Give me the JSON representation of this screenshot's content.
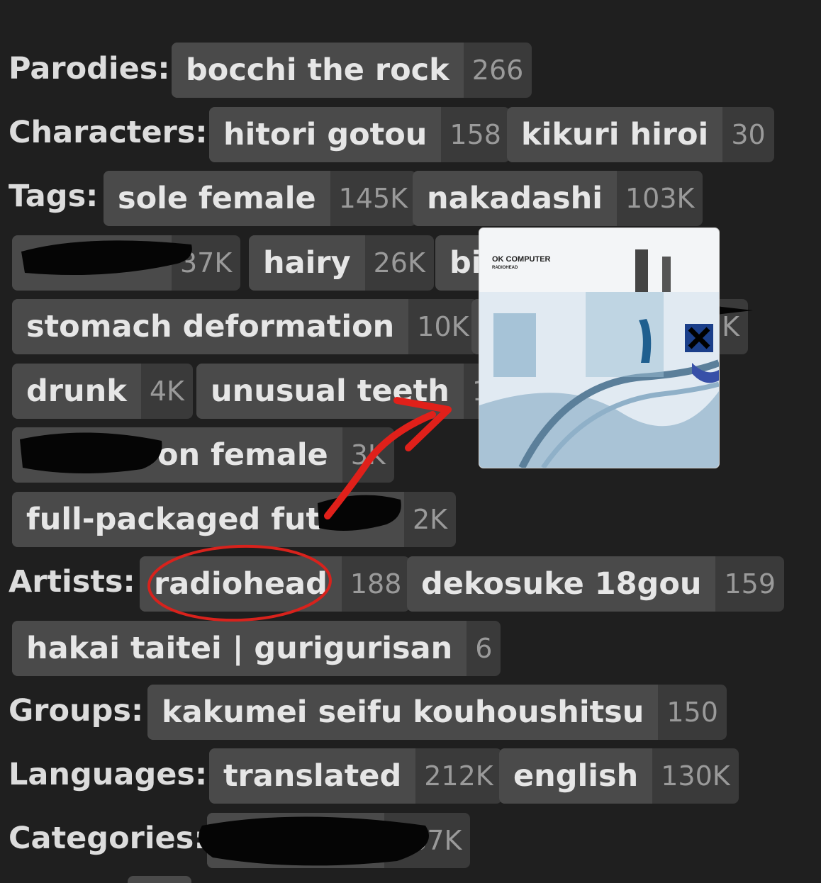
{
  "sections": {
    "parodies": "Parodies:",
    "characters": "Characters:",
    "tags": "Tags:",
    "artists": "Artists:",
    "groups": "Groups:",
    "languages": "Languages:",
    "categories": "Categories:"
  },
  "parodies": [
    {
      "name": "bocchi the rock",
      "count": "266"
    }
  ],
  "characters": [
    {
      "name": "hitori gotou",
      "count": "158"
    },
    {
      "name": "kikuri hiroi",
      "count": "30"
    }
  ],
  "tags": [
    {
      "name": "sole female",
      "count": "145K"
    },
    {
      "name": "nakadashi",
      "count": "103K"
    },
    {
      "name": "",
      "count": "37K"
    },
    {
      "name": "hairy",
      "count": "26K"
    },
    {
      "name": "bi",
      "count": ""
    },
    {
      "name": "stomach deformation",
      "count": "10K"
    },
    {
      "name": "",
      "count": "K"
    },
    {
      "name": "drunk",
      "count": "4K"
    },
    {
      "name": "unusual teeth",
      "count": "1"
    },
    {
      "name": "on female",
      "count": "3K"
    },
    {
      "name": "full-packaged fut",
      "count": "2K"
    }
  ],
  "artists": [
    {
      "name": "radiohead",
      "count": "188"
    },
    {
      "name": "dekosuke 18gou",
      "count": "159"
    },
    {
      "name": "hakai taitei | gurigurisan",
      "count": "6"
    }
  ],
  "groups": [
    {
      "name": "kakumei seifu kouhoushitsu",
      "count": "150"
    }
  ],
  "languages": [
    {
      "name": "translated",
      "count": "212K"
    },
    {
      "name": "english",
      "count": "130K"
    }
  ],
  "categories": [
    {
      "name": "",
      "count": "287K"
    }
  ],
  "album": {
    "title": "OK COMPUTER",
    "artist": "RADIOHEAD"
  },
  "colors": {
    "background": "#1f1f1f",
    "tag_name_bg": "#4a4a4a",
    "tag_count_bg": "#3a3a3a",
    "highlight_red": "#e0201a"
  }
}
